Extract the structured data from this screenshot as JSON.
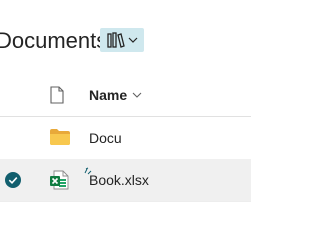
{
  "header": {
    "title": "Documents",
    "view_switcher": {
      "icon": "library-books-icon",
      "caret_icon": "chevron-down-icon",
      "accent": "#cfe8ee"
    }
  },
  "columns": {
    "file_type_icon": "document-icon",
    "name_label": "Name",
    "sort_icon": "chevron-down-icon"
  },
  "rows": [
    {
      "type": "folder",
      "icon": "folder-icon",
      "name": "Docu",
      "selected": false
    },
    {
      "type": "excel",
      "icon": "excel-file-icon",
      "name": "Book.xlsx",
      "selected": true,
      "new_indicator": "sparkle-icon"
    }
  ],
  "colors": {
    "folder": "#f3c443",
    "excel": "#107c41",
    "check": "#125f6e",
    "selected_row": "#f0f0f0"
  }
}
